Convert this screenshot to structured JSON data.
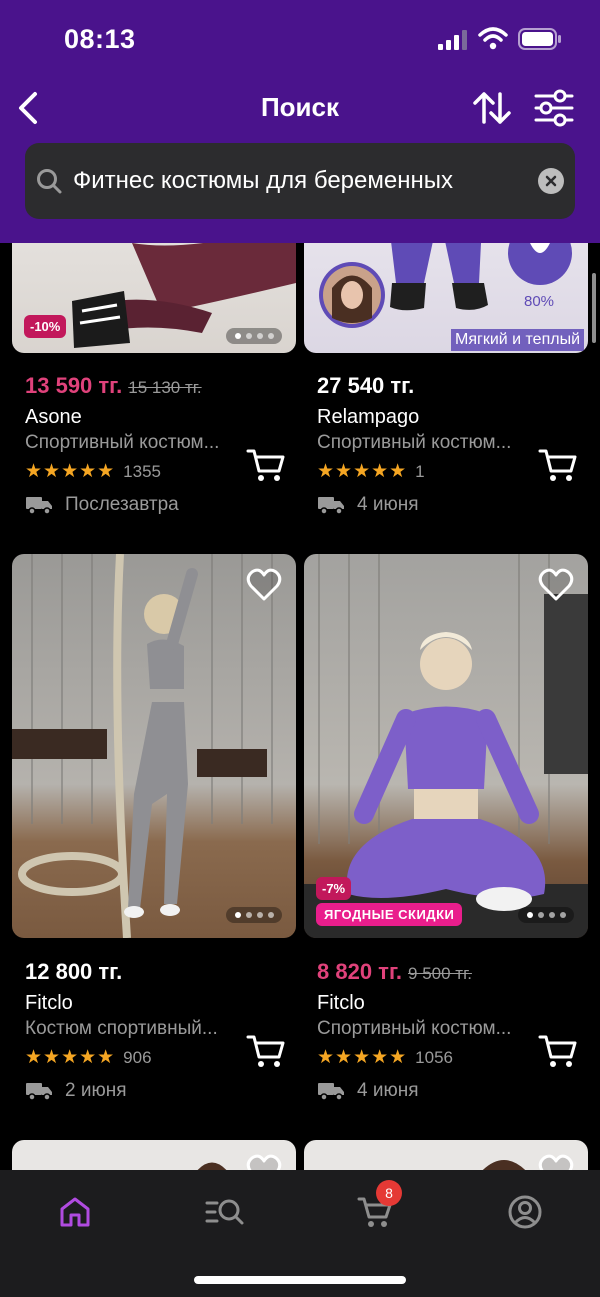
{
  "status_bar": {
    "time": "08:13"
  },
  "nav": {
    "title": "Поиск"
  },
  "search": {
    "value": "Фитнес костюмы для беременных"
  },
  "products": [
    {
      "discount": "-10%",
      "price": "13 590 тг.",
      "old_price": "15 130 тг.",
      "brand": "Asone",
      "name": "Спортивный костюм...",
      "rating_count": "1355",
      "delivery": "Послезавтра"
    },
    {
      "overlay_text": "Мягкий и теплый",
      "percent": "80%",
      "price": "27 540 тг.",
      "brand": "Relampago",
      "name": "Спортивный костюм...",
      "rating_count": "1",
      "delivery": "4 июня"
    },
    {
      "price": "12 800 тг.",
      "brand": "Fitclo",
      "name": "Костюм спортивный...",
      "rating_count": "906",
      "delivery": "2 июня"
    },
    {
      "discount": "-7%",
      "promo": "ЯГОДНЫЕ СКИДКИ",
      "price": "8 820 тг.",
      "old_price": "9 500 тг.",
      "brand": "Fitclo",
      "name": "Спортивный костюм...",
      "rating_count": "1056",
      "delivery": "4 июня"
    }
  ],
  "stars": "★★★★★",
  "tabbar": {
    "cart_count": "8"
  },
  "colors": {
    "header": "#4a138c",
    "accent": "#e0427b",
    "active_tab": "#b04be0",
    "star": "#f5a623"
  }
}
